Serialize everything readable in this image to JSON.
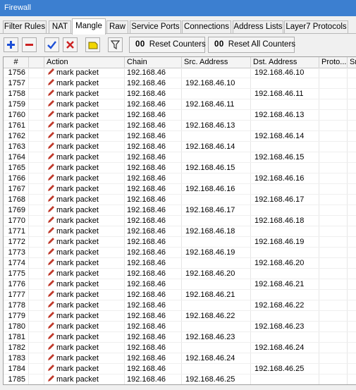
{
  "window": {
    "title": "Firewall"
  },
  "tabs": [
    {
      "label": "Filter Rules"
    },
    {
      "label": "NAT"
    },
    {
      "label": "Mangle"
    },
    {
      "label": "Raw"
    },
    {
      "label": "Service Ports"
    },
    {
      "label": "Connections"
    },
    {
      "label": "Address Lists"
    },
    {
      "label": "Layer7 Protocols"
    }
  ],
  "active_tab": "Mangle",
  "toolbar": {
    "add_icon": "plus-icon",
    "remove_icon": "minus-icon",
    "enable_icon": "check-icon",
    "disable_icon": "x-icon",
    "comment_icon": "note-icon",
    "filter_icon": "funnel-icon",
    "reset_counters_label": "Reset Counters",
    "reset_all_counters_label": "Reset All Counters",
    "counter_glyph": "00"
  },
  "table": {
    "columns": [
      "#",
      "",
      "Action",
      "Chain",
      "Src. Address",
      "Dst. Address",
      "Proto...",
      "Src"
    ],
    "rows": [
      {
        "num": "1756",
        "action": "mark packet",
        "chain": "192.168.46",
        "src": "",
        "dst": "192.168.46.10"
      },
      {
        "num": "1757",
        "action": "mark packet",
        "chain": "192.168.46",
        "src": "192.168.46.10",
        "dst": ""
      },
      {
        "num": "1758",
        "action": "mark packet",
        "chain": "192.168.46",
        "src": "",
        "dst": "192.168.46.11"
      },
      {
        "num": "1759",
        "action": "mark packet",
        "chain": "192.168.46",
        "src": "192.168.46.11",
        "dst": ""
      },
      {
        "num": "1760",
        "action": "mark packet",
        "chain": "192.168.46",
        "src": "",
        "dst": "192.168.46.13"
      },
      {
        "num": "1761",
        "action": "mark packet",
        "chain": "192.168.46",
        "src": "192.168.46.13",
        "dst": ""
      },
      {
        "num": "1762",
        "action": "mark packet",
        "chain": "192.168.46",
        "src": "",
        "dst": "192.168.46.14"
      },
      {
        "num": "1763",
        "action": "mark packet",
        "chain": "192.168.46",
        "src": "192.168.46.14",
        "dst": ""
      },
      {
        "num": "1764",
        "action": "mark packet",
        "chain": "192.168.46",
        "src": "",
        "dst": "192.168.46.15"
      },
      {
        "num": "1765",
        "action": "mark packet",
        "chain": "192.168.46",
        "src": "192.168.46.15",
        "dst": ""
      },
      {
        "num": "1766",
        "action": "mark packet",
        "chain": "192.168.46",
        "src": "",
        "dst": "192.168.46.16"
      },
      {
        "num": "1767",
        "action": "mark packet",
        "chain": "192.168.46",
        "src": "192.168.46.16",
        "dst": ""
      },
      {
        "num": "1768",
        "action": "mark packet",
        "chain": "192.168.46",
        "src": "",
        "dst": "192.168.46.17"
      },
      {
        "num": "1769",
        "action": "mark packet",
        "chain": "192.168.46",
        "src": "192.168.46.17",
        "dst": ""
      },
      {
        "num": "1770",
        "action": "mark packet",
        "chain": "192.168.46",
        "src": "",
        "dst": "192.168.46.18"
      },
      {
        "num": "1771",
        "action": "mark packet",
        "chain": "192.168.46",
        "src": "192.168.46.18",
        "dst": ""
      },
      {
        "num": "1772",
        "action": "mark packet",
        "chain": "192.168.46",
        "src": "",
        "dst": "192.168.46.19"
      },
      {
        "num": "1773",
        "action": "mark packet",
        "chain": "192.168.46",
        "src": "192.168.46.19",
        "dst": ""
      },
      {
        "num": "1774",
        "action": "mark packet",
        "chain": "192.168.46",
        "src": "",
        "dst": "192.168.46.20"
      },
      {
        "num": "1775",
        "action": "mark packet",
        "chain": "192.168.46",
        "src": "192.168.46.20",
        "dst": ""
      },
      {
        "num": "1776",
        "action": "mark packet",
        "chain": "192.168.46",
        "src": "",
        "dst": "192.168.46.21"
      },
      {
        "num": "1777",
        "action": "mark packet",
        "chain": "192.168.46",
        "src": "192.168.46.21",
        "dst": ""
      },
      {
        "num": "1778",
        "action": "mark packet",
        "chain": "192.168.46",
        "src": "",
        "dst": "192.168.46.22"
      },
      {
        "num": "1779",
        "action": "mark packet",
        "chain": "192.168.46",
        "src": "192.168.46.22",
        "dst": ""
      },
      {
        "num": "1780",
        "action": "mark packet",
        "chain": "192.168.46",
        "src": "",
        "dst": "192.168.46.23"
      },
      {
        "num": "1781",
        "action": "mark packet",
        "chain": "192.168.46",
        "src": "192.168.46.23",
        "dst": ""
      },
      {
        "num": "1782",
        "action": "mark packet",
        "chain": "192.168.46",
        "src": "",
        "dst": "192.168.46.24"
      },
      {
        "num": "1783",
        "action": "mark packet",
        "chain": "192.168.46",
        "src": "192.168.46.24",
        "dst": ""
      },
      {
        "num": "1784",
        "action": "mark packet",
        "chain": "192.168.46",
        "src": "",
        "dst": "192.168.46.25"
      },
      {
        "num": "1785",
        "action": "mark packet",
        "chain": "192.168.46",
        "src": "192.168.46.25",
        "dst": ""
      }
    ]
  },
  "colors": {
    "titlebar": "#3c7fd0",
    "add": "#1c4fd6",
    "remove": "#cc2222",
    "enable": "#1c4fd6",
    "disable": "#cc2222",
    "comment": "#f2d600",
    "action_icon": "#c0392b"
  }
}
